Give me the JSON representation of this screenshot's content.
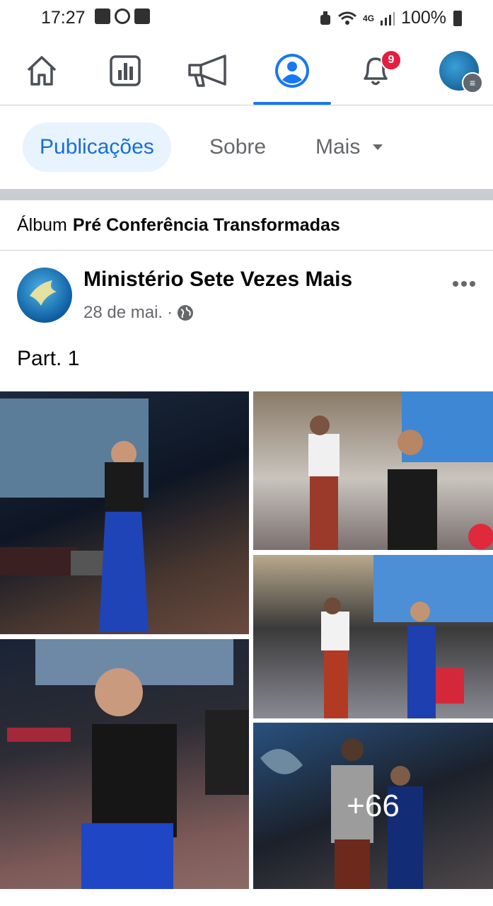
{
  "status_bar": {
    "time": "17:27",
    "battery": "100%",
    "network": "4G"
  },
  "nav": {
    "items": [
      {
        "name": "home"
      },
      {
        "name": "feed"
      },
      {
        "name": "ads"
      },
      {
        "name": "profile"
      },
      {
        "name": "notifications",
        "badge": "9"
      },
      {
        "name": "menu"
      }
    ]
  },
  "tabs": {
    "posts": "Publicações",
    "about": "Sobre",
    "more": "Mais"
  },
  "album": {
    "prefix": "Álbum",
    "name": "Pré Conferência Transformadas"
  },
  "post": {
    "author": "Ministério Sete Vezes Mais",
    "date": "28 de mai.",
    "separator": "·",
    "text": "Part. 1",
    "more_photos": "+66"
  },
  "colors": {
    "accent": "#1877f2",
    "badge": "#e41e3f"
  }
}
